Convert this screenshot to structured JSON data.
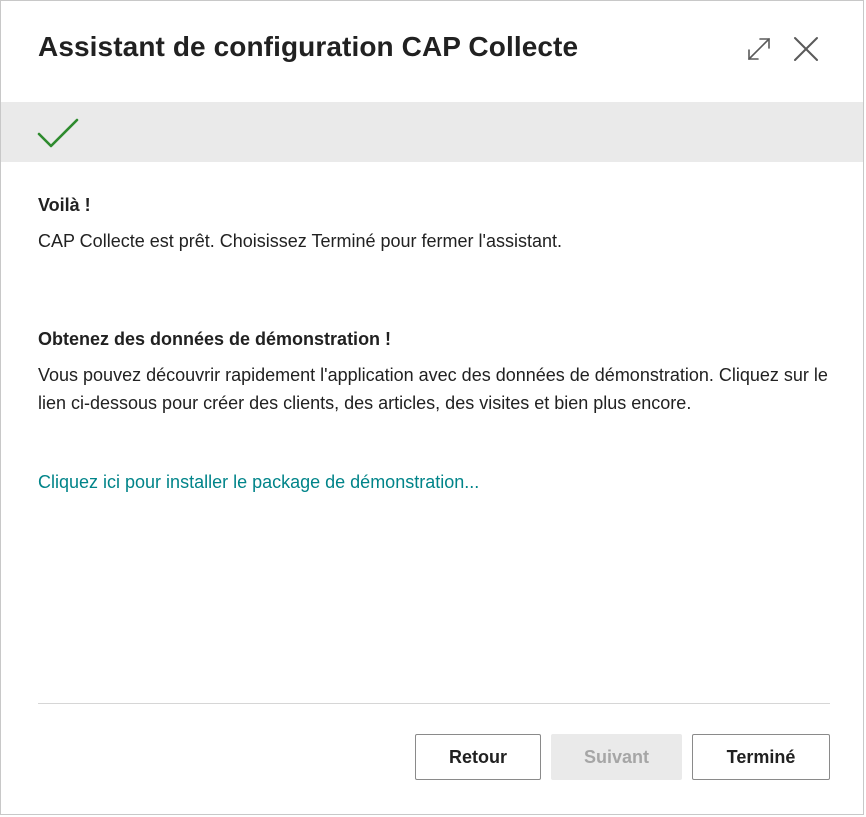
{
  "dialog": {
    "title": "Assistant de configuration CAP Collecte",
    "expand_icon": "expand-icon",
    "close_icon": "close-icon"
  },
  "banner": {
    "status_icon": "checkmark-icon",
    "status_color": "#2e8b2e"
  },
  "content": {
    "section1": {
      "heading": "Voilà !",
      "text": "CAP Collecte est prêt. Choisissez Terminé pour fermer l'assistant."
    },
    "section2": {
      "heading": "Obtenez des données de démonstration !",
      "text": "Vous pouvez découvrir rapidement l'application avec des données de démonstration. Cliquez sur le lien ci-dessous pour créer des clients, des articles, des visites et bien plus encore."
    },
    "demo_link": "Cliquez ici pour installer le package de démonstration...",
    "link_color": "#008489"
  },
  "footer": {
    "back_label": "Retour",
    "next_label": "Suivant",
    "next_disabled": true,
    "finish_label": "Terminé"
  }
}
